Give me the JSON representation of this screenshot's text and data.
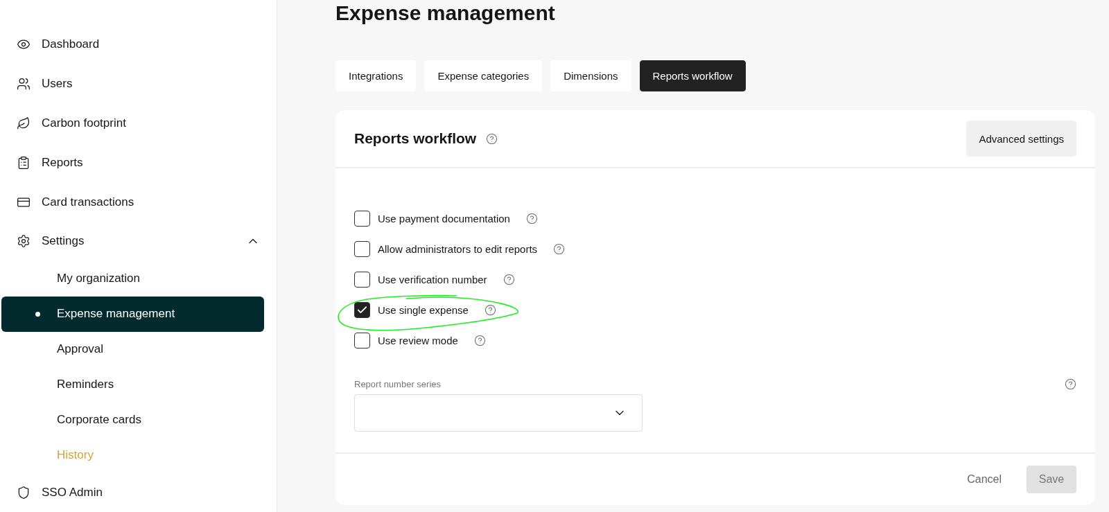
{
  "sidebar": {
    "items": [
      {
        "kind": "eye",
        "label": "Dashboard",
        "selected": false
      },
      {
        "kind": "users",
        "label": "Users",
        "selected": false
      },
      {
        "kind": "leaf",
        "label": "Carbon footprint",
        "selected": false
      },
      {
        "kind": "clipboard",
        "label": "Reports",
        "selected": false
      },
      {
        "kind": "card",
        "label": "Card transactions",
        "selected": false
      },
      {
        "kind": "gear",
        "label": "Settings",
        "selected": false,
        "expanded": true,
        "children": [
          {
            "label": "My organization",
            "selected": false,
            "hovered": false
          },
          {
            "label": "Expense management",
            "selected": true,
            "hovered": false
          },
          {
            "label": "Approval",
            "selected": false,
            "hovered": false
          },
          {
            "label": "Reminders",
            "selected": false,
            "hovered": false
          },
          {
            "label": "Corporate cards",
            "selected": false,
            "hovered": false
          },
          {
            "label": "History",
            "selected": false,
            "hovered": true
          }
        ]
      },
      {
        "kind": "shield",
        "label": "SSO Admin",
        "selected": false
      }
    ]
  },
  "page_title": "Expense management",
  "tabs": [
    {
      "label": "Integrations",
      "selected": false
    },
    {
      "label": "Expense categories",
      "selected": false
    },
    {
      "label": "Dimensions",
      "selected": false
    },
    {
      "label": "Reports workflow",
      "selected": true
    }
  ],
  "card": {
    "title": "Reports workflow",
    "header_button": "Advanced settings",
    "options": [
      {
        "label": "Use payment documentation",
        "checked": false
      },
      {
        "label": "Allow administrators to edit reports",
        "checked": false
      },
      {
        "label": "Use verification number",
        "checked": false
      },
      {
        "label": "Use single expense",
        "checked": true
      },
      {
        "label": "Use review mode",
        "checked": false
      }
    ],
    "report_number_series": {
      "label": "Report number series"
    },
    "footer": {
      "cancel": "Cancel",
      "save": "Save",
      "save_disabled": true
    }
  }
}
